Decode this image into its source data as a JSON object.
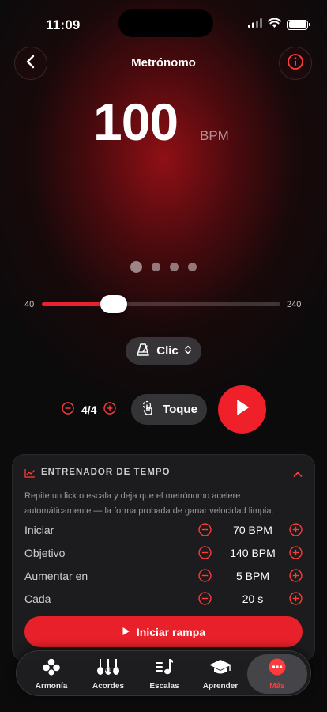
{
  "status_bar": {
    "time": "11:09"
  },
  "header": {
    "title": "Metrónomo"
  },
  "bpm": {
    "value": "100",
    "unit": "BPM"
  },
  "slider": {
    "min": "40",
    "max": "240",
    "value": 100
  },
  "sound": {
    "label": "Clic"
  },
  "time_signature": {
    "value": "4/4"
  },
  "tap": {
    "label": "Toque"
  },
  "trainer": {
    "title": "ENTRENADOR DE TEMPO",
    "description": "Repite un lick o escala y deja que el metrónomo acelere automáticamente — la forma probada de ganar velocidad limpia.",
    "rows": [
      {
        "label": "Iniciar",
        "value": "70 BPM"
      },
      {
        "label": "Objetivo",
        "value": "140 BPM"
      },
      {
        "label": "Aumentar en",
        "value": "5 BPM"
      },
      {
        "label": "Cada",
        "value": "20 s"
      }
    ],
    "start_button": "Iniciar rampa"
  },
  "tabs": [
    {
      "label": "Armonía",
      "icon": "harmony-icon"
    },
    {
      "label": "Acordes",
      "icon": "guitars-icon"
    },
    {
      "label": "Escalas",
      "icon": "music-note-icon"
    },
    {
      "label": "Aprender",
      "icon": "graduation-cap-icon"
    },
    {
      "label": "Más",
      "icon": "more-icon",
      "active": true
    }
  ],
  "colors": {
    "accent": "#e8232d",
    "background": "#0b0b0c",
    "card": "#1c1c1e"
  }
}
